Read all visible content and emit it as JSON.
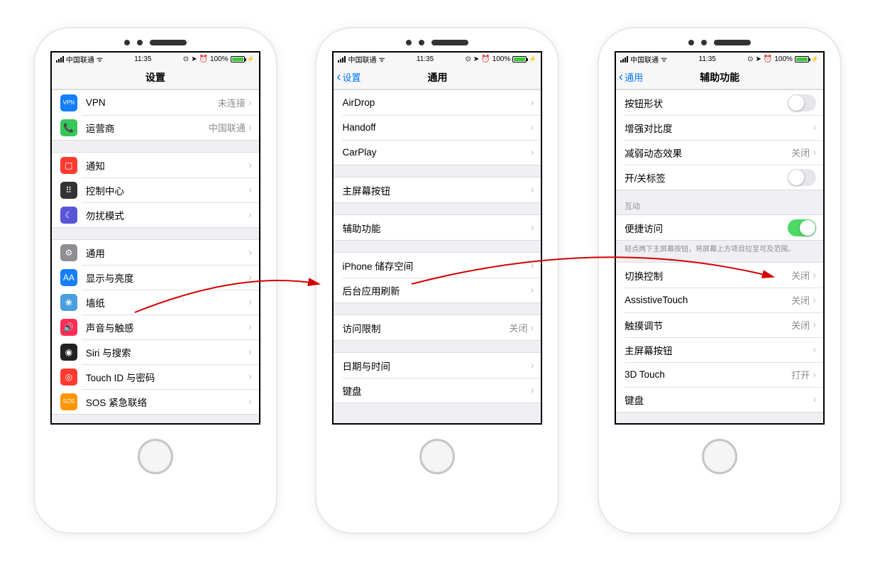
{
  "status": {
    "carrier": "中国联通",
    "time": "11:35",
    "battery": "100%"
  },
  "phone1": {
    "title": "设置",
    "g1": [
      {
        "icon": "ic-vpn",
        "iconText": "VPN",
        "label": "VPN",
        "detail": "未连接"
      },
      {
        "icon": "ic-carrier",
        "iconText": "📞",
        "label": "运营商",
        "detail": "中国联通"
      }
    ],
    "g2": [
      {
        "icon": "ic-notif",
        "iconText": "▢",
        "label": "通知"
      },
      {
        "icon": "ic-control",
        "iconText": "⠿",
        "label": "控制中心"
      },
      {
        "icon": "ic-dnd",
        "iconText": "☾",
        "label": "勿扰模式"
      }
    ],
    "g3": [
      {
        "icon": "ic-general",
        "iconText": "⚙",
        "label": "通用"
      },
      {
        "icon": "ic-display",
        "iconText": "AA",
        "label": "显示与亮度"
      },
      {
        "icon": "ic-wallpaper",
        "iconText": "❀",
        "label": "墙纸"
      },
      {
        "icon": "ic-sound",
        "iconText": "🔊",
        "label": "声音与触感"
      },
      {
        "icon": "ic-siri",
        "iconText": "◉",
        "label": "Siri 与搜索"
      },
      {
        "icon": "ic-touchid",
        "iconText": "◎",
        "label": "Touch ID 与密码"
      },
      {
        "icon": "ic-sos",
        "iconText": "SOS",
        "label": "SOS 紧急联络"
      }
    ]
  },
  "phone2": {
    "back": "设置",
    "title": "通用",
    "g1": [
      {
        "label": "AirDrop"
      },
      {
        "label": "Handoff"
      },
      {
        "label": "CarPlay"
      }
    ],
    "g2": [
      {
        "label": "主屏幕按钮"
      }
    ],
    "g3": [
      {
        "label": "辅助功能"
      }
    ],
    "g4": [
      {
        "label": "iPhone 储存空间"
      },
      {
        "label": "后台应用刷新"
      }
    ],
    "g5": [
      {
        "label": "访问限制",
        "detail": "关闭"
      }
    ],
    "g6": [
      {
        "label": "日期与时间"
      },
      {
        "label": "键盘"
      }
    ]
  },
  "phone3": {
    "back": "通用",
    "title": "辅助功能",
    "g1": [
      {
        "label": "按钮形状",
        "toggle": false
      },
      {
        "label": "增强对比度",
        "chev": true
      },
      {
        "label": "减弱动态效果",
        "detail": "关闭",
        "chev": true
      },
      {
        "label": "开/关标签",
        "toggle": false
      }
    ],
    "section2": "互动",
    "g2": [
      {
        "label": "便捷访问",
        "toggle": true
      }
    ],
    "note2": "轻点两下主屏幕按钮，将屏幕上方项目拉至可及范围。",
    "g3": [
      {
        "label": "切换控制",
        "detail": "关闭",
        "chev": true
      },
      {
        "label": "AssistiveTouch",
        "detail": "关闭",
        "chev": true
      },
      {
        "label": "触摸调节",
        "detail": "关闭",
        "chev": true
      },
      {
        "label": "主屏幕按钮",
        "chev": true
      },
      {
        "label": "3D Touch",
        "detail": "打开",
        "chev": true
      },
      {
        "label": "键盘",
        "chev": true
      }
    ]
  }
}
